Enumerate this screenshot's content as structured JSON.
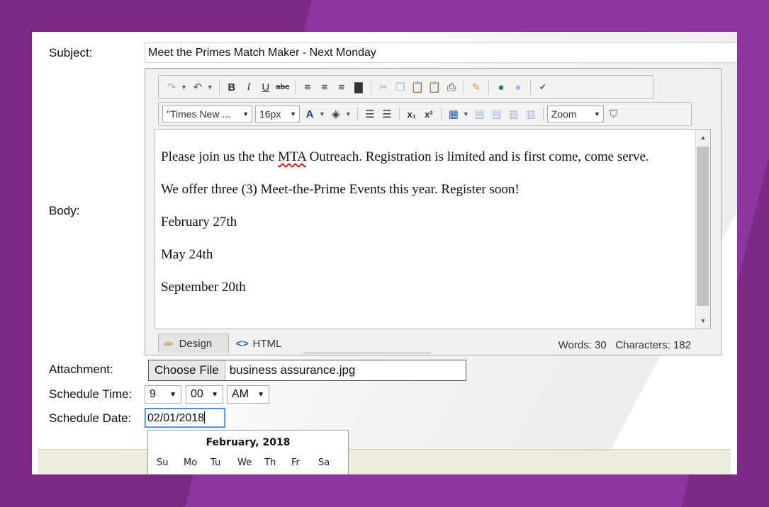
{
  "form": {
    "subject_label": "Subject:",
    "subject_value": "Meet the Primes Match Maker - Next Monday",
    "body_label": "Body:",
    "attachment_label": "Attachment:",
    "schedule_time_label": "Schedule Time:",
    "schedule_date_label": "Schedule Date:",
    "schedule_date_value": "02/01/2018"
  },
  "toolbar": {
    "font_family": "\"Times New ...",
    "font_size": "16px",
    "zoom": "Zoom",
    "bold": "B",
    "italic": "I",
    "underline": "U",
    "strike": "abc",
    "font_color": "A",
    "subscript": "x₁",
    "superscript": "x²"
  },
  "body": {
    "p1_before": "Please join us the the ",
    "p1_misspelled": "MTA",
    "p1_after": " Outreach. Registration is limited and is first come, come serve.",
    "p2": "We offer three (3) Meet-the-Prime Events this year. Register soon!",
    "p3": "February 27th",
    "p4": "May 24th",
    "p5": "September 20th"
  },
  "editor_footer": {
    "design_tab": "Design",
    "html_tab": "HTML",
    "words": "Words: 30",
    "characters": "Characters: 182"
  },
  "attachment": {
    "button_label": "Choose File",
    "file_name": "business assurance.jpg"
  },
  "schedule_time": {
    "hour": "9",
    "minute": "00",
    "ampm": "AM"
  },
  "calendar": {
    "month_title": "February, 2018",
    "weekdays": [
      "Su",
      "Mo",
      "Tu",
      "We",
      "Th",
      "Fr",
      "Sa"
    ]
  },
  "colors": {
    "background": "#7b2a86",
    "focus_border": "#3b7bd8",
    "spellcheck": "#dd1111"
  }
}
